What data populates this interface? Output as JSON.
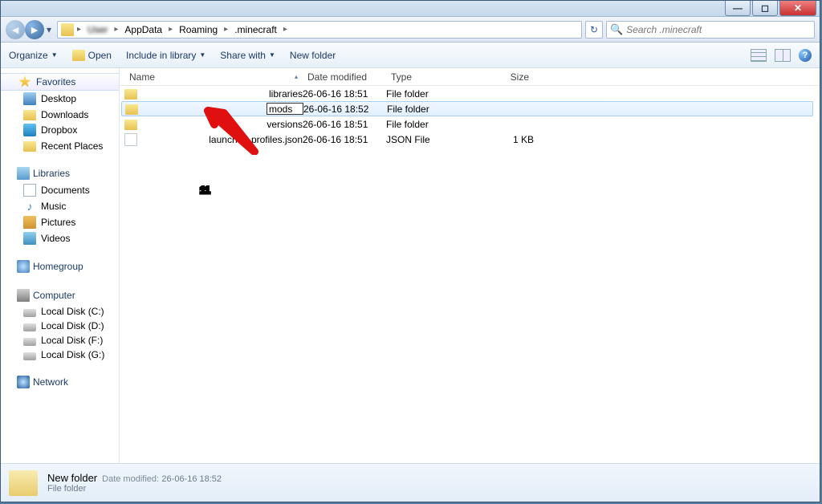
{
  "breadcrumbs": {
    "segments": [
      "AppData",
      "Roaming",
      ".minecraft"
    ]
  },
  "search": {
    "placeholder": "Search .minecraft"
  },
  "toolbar": {
    "organize": "Organize",
    "open": "Open",
    "include": "Include in library",
    "share": "Share with",
    "newfolder": "New folder"
  },
  "sidebar": {
    "favorites": {
      "label": "Favorites",
      "items": [
        "Desktop",
        "Downloads",
        "Dropbox",
        "Recent Places"
      ]
    },
    "libraries": {
      "label": "Libraries",
      "items": [
        "Documents",
        "Music",
        "Pictures",
        "Videos"
      ]
    },
    "homegroup": {
      "label": "Homegroup"
    },
    "computer": {
      "label": "Computer",
      "items": [
        "Local Disk (C:)",
        "Local Disk (D:)",
        "Local Disk (F:)",
        "Local Disk (G:)"
      ]
    },
    "network": {
      "label": "Network"
    }
  },
  "columns": {
    "name": "Name",
    "date": "Date modified",
    "type": "Type",
    "size": "Size"
  },
  "files": [
    {
      "name": "libraries",
      "date": "26-06-16 18:51",
      "type": "File folder",
      "size": "",
      "icon": "folder"
    },
    {
      "name": "mods",
      "date": "26-06-16 18:52",
      "type": "File folder",
      "size": "",
      "icon": "folder",
      "selected": true,
      "renaming": true
    },
    {
      "name": "versions",
      "date": "26-06-16 18:51",
      "type": "File folder",
      "size": "",
      "icon": "folder"
    },
    {
      "name": "launcher_profiles.json",
      "date": "26-06-16 18:51",
      "type": "JSON File",
      "size": "1 KB",
      "icon": "file"
    }
  ],
  "status": {
    "title": "New folder",
    "date_label": "Date modified:",
    "date": "26-06-16 18:52",
    "type": "File folder"
  },
  "annotation": {
    "number": "11"
  }
}
